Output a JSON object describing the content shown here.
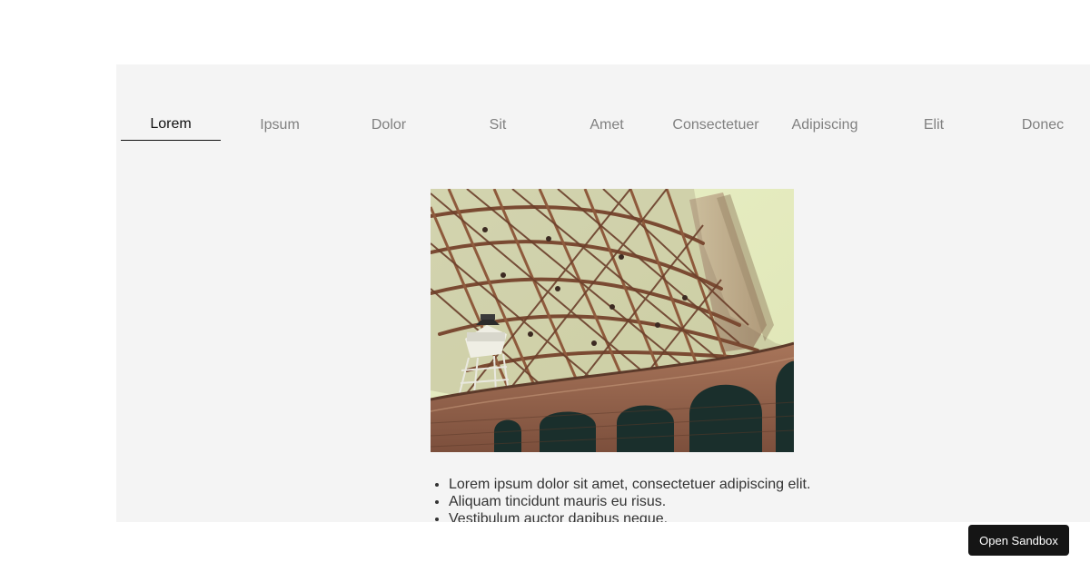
{
  "tabs": [
    {
      "label": "Lorem",
      "active": true
    },
    {
      "label": "Ipsum",
      "active": false
    },
    {
      "label": "Dolor",
      "active": false
    },
    {
      "label": "Sit",
      "active": false
    },
    {
      "label": "Amet",
      "active": false
    },
    {
      "label": "Consectetuer",
      "active": false
    },
    {
      "label": "Adipiscing",
      "active": false
    },
    {
      "label": "Elit",
      "active": false
    },
    {
      "label": "Donec",
      "active": false
    }
  ],
  "content": {
    "bullets": [
      "Lorem ipsum dolor sit amet, consectetuer adipiscing elit.",
      "Aliquam tincidunt mauris eu risus.",
      "Vestibulum auctor dapibus neque."
    ]
  },
  "sandbox_button": {
    "label": "Open Sandbox"
  },
  "colors": {
    "frame_background": "#f4f4f4",
    "active_tab_text": "#111111",
    "inactive_tab_text": "#808080",
    "button_background": "#151515"
  }
}
